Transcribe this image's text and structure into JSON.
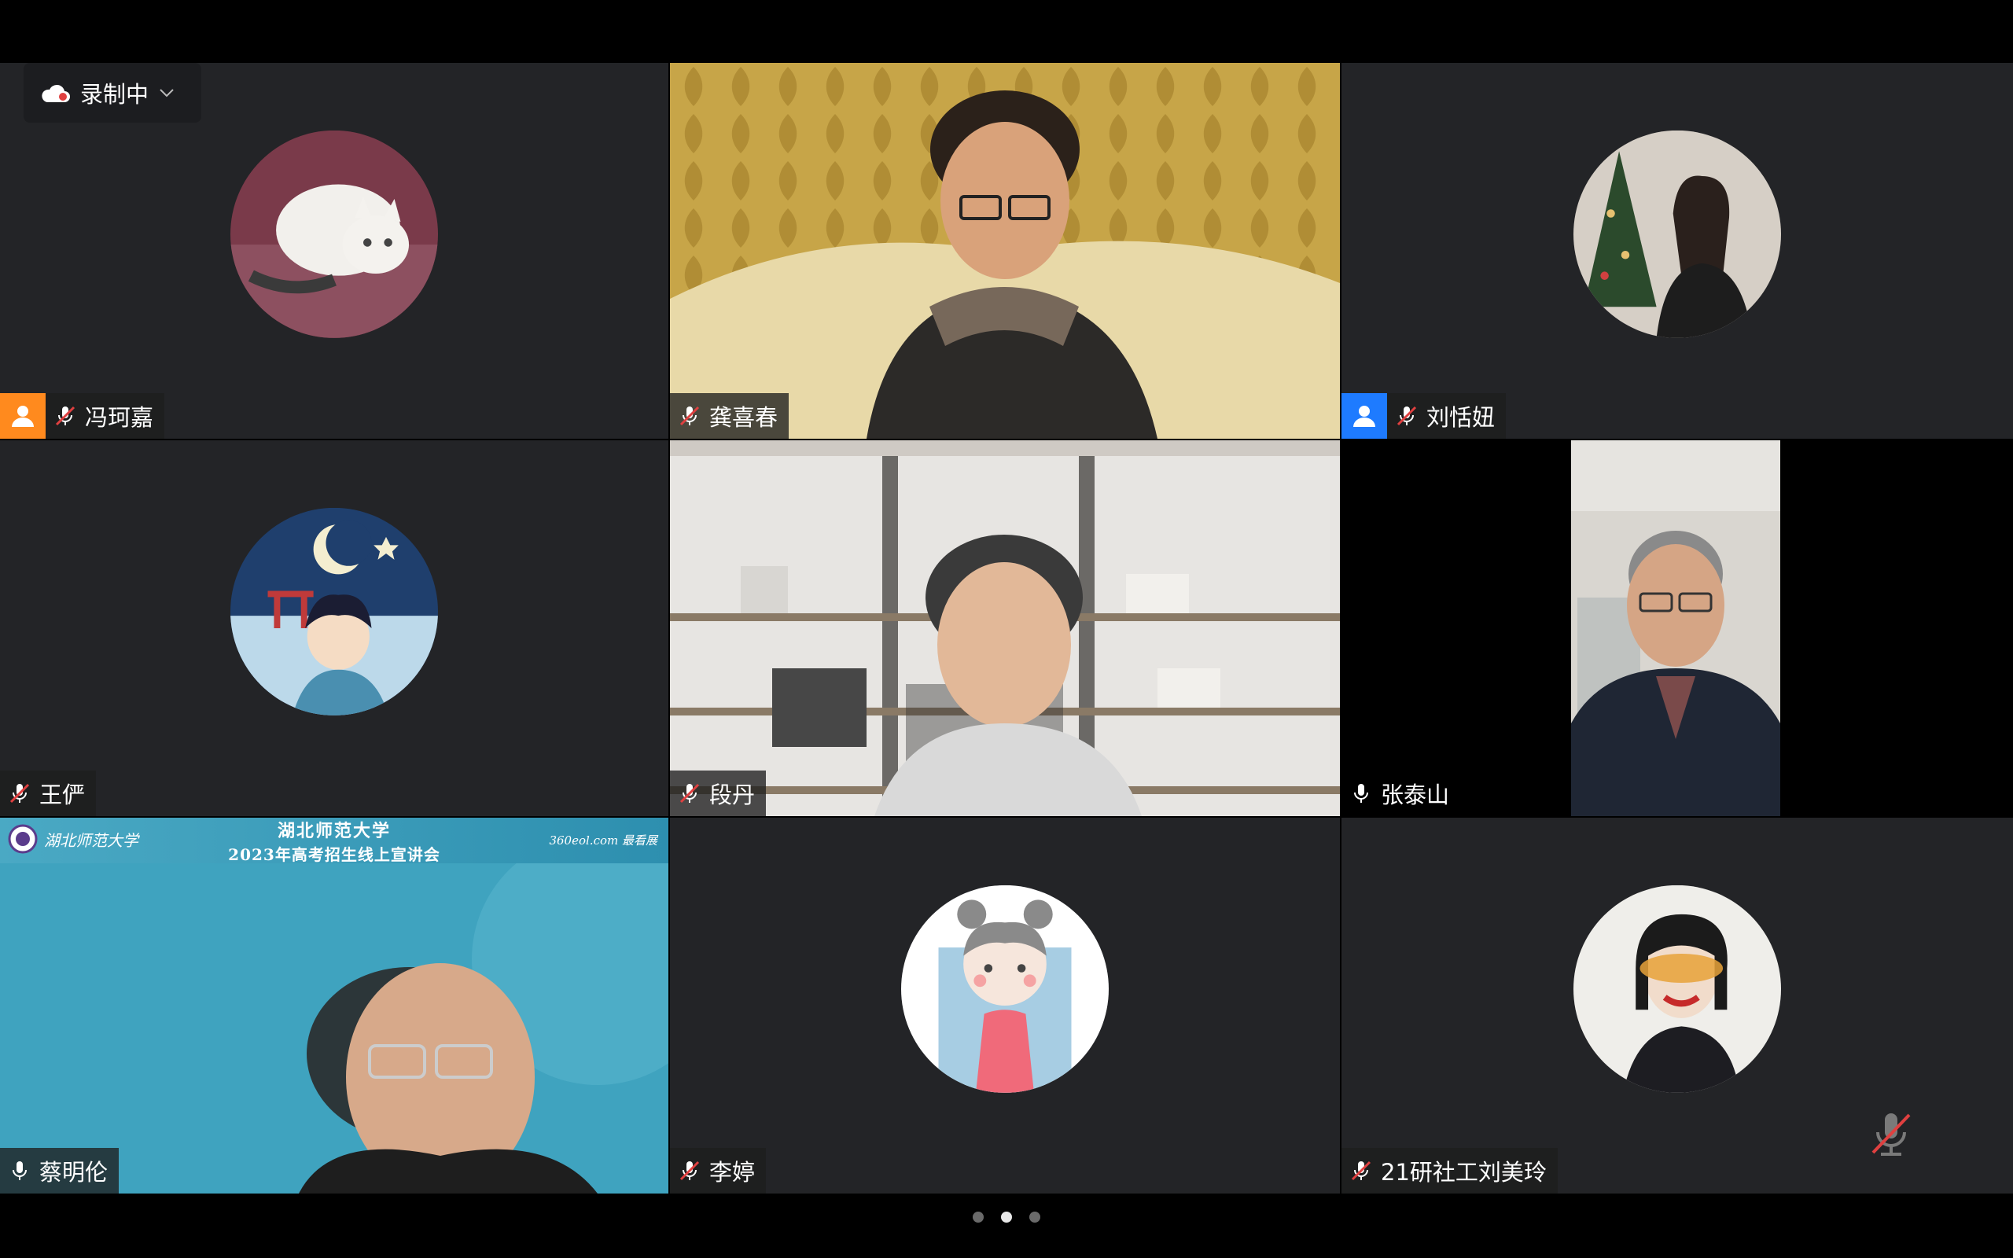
{
  "recording": {
    "label": "录制中"
  },
  "participants": [
    {
      "name": "冯珂嘉",
      "mic": "muted",
      "badge": "orange"
    },
    {
      "name": "龚喜春",
      "mic": "muted"
    },
    {
      "name": "刘恬妞",
      "mic": "muted",
      "badge": "blue"
    },
    {
      "name": "王俨",
      "mic": "muted"
    },
    {
      "name": "段丹",
      "mic": "muted"
    },
    {
      "name": "张泰山",
      "mic": "on"
    },
    {
      "name": "蔡明伦",
      "mic": "on"
    },
    {
      "name": "李婷",
      "mic": "muted"
    },
    {
      "name": "21研社工刘美玲",
      "mic": "muted"
    }
  ],
  "banner": {
    "title_line1": "湖北师范大学",
    "title_line2": "2023年高考招生线上宣讲会",
    "logo_left": "湖北师范大学",
    "logo_right": "360eol.com 最看展"
  },
  "pager": {
    "pages": 3,
    "current": 2
  },
  "colors": {
    "tile_bg": "#232427",
    "badge_orange": "#ff8a1e",
    "badge_blue": "#1e7bff",
    "mute_red": "#e04040"
  }
}
